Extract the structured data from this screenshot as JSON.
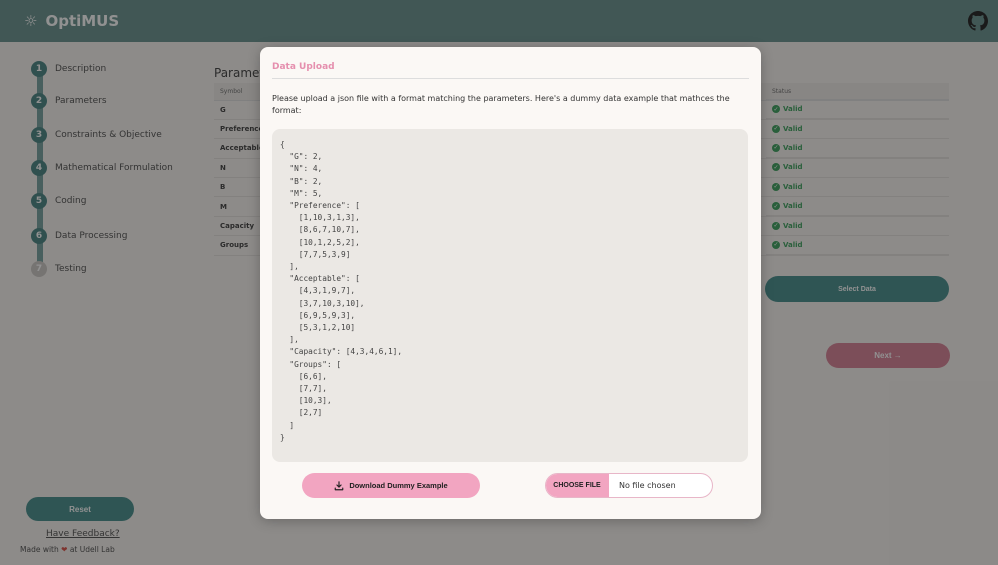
{
  "app": {
    "title": "OptiMUS"
  },
  "colors": {
    "teal": "#5f8a87",
    "accent_teal": "#3a8785",
    "pink": "#f2a5c1",
    "valid_green": "#2f9a52"
  },
  "steps": [
    {
      "num": "1",
      "label": "Description"
    },
    {
      "num": "2",
      "label": "Parameters"
    },
    {
      "num": "3",
      "label": "Constraints & Objective"
    },
    {
      "num": "4",
      "label": "Mathematical Formulation"
    },
    {
      "num": "5",
      "label": "Coding"
    },
    {
      "num": "6",
      "label": "Data Processing"
    },
    {
      "num": "7",
      "label": "Testing"
    }
  ],
  "sidebar": {
    "reset_label": "Reset",
    "feedback_label": "Have Feedback?",
    "made_with_prefix": "Made with",
    "made_with_suffix": "at Udell Lab"
  },
  "main": {
    "params_title": "Paramet",
    "table_headers": {
      "symbol": "Symbol",
      "status": "Status"
    },
    "rows": [
      {
        "symbol": "G",
        "status": "Valid"
      },
      {
        "symbol": "Preference",
        "status": "Valid"
      },
      {
        "symbol": "Acceptable",
        "status": "Valid"
      },
      {
        "symbol": "N",
        "status": "Valid"
      },
      {
        "symbol": "B",
        "status": "Valid"
      },
      {
        "symbol": "M",
        "status": "Valid"
      },
      {
        "symbol": "Capacity",
        "status": "Valid"
      },
      {
        "symbol": "Groups",
        "status": "Valid"
      }
    ],
    "select_data_label": "Select Data",
    "next_label": "Next →"
  },
  "modal": {
    "title": "Data Upload",
    "description": "Please upload a json file with a format matching the parameters. Here's a dummy data example that mathces the format:",
    "code": "{\n  \"G\": 2,\n  \"N\": 4,\n  \"B\": 2,\n  \"M\": 5,\n  \"Preference\": [\n    [1,10,3,1,3],\n    [8,6,7,10,7],\n    [10,1,2,5,2],\n    [7,7,5,3,9]\n  ],\n  \"Acceptable\": [\n    [4,3,1,9,7],\n    [3,7,10,3,10],\n    [6,9,5,9,3],\n    [5,3,1,2,10]\n  ],\n  \"Capacity\": [4,3,4,6,1],\n  \"Groups\": [\n    [6,6],\n    [7,7],\n    [10,3],\n    [2,7]\n  ]\n}",
    "download_label": "Download Dummy Example",
    "choose_file_label": "CHOOSE FILE",
    "file_status": "No file chosen"
  }
}
